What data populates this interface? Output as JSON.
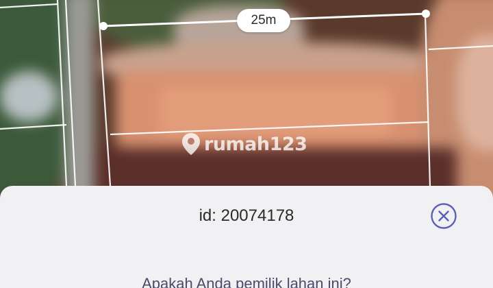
{
  "map": {
    "measurement_label": "25m",
    "watermark_text": "rumah123",
    "watermark_icon": "location-pin-icon",
    "boundary_color": "#ffffff"
  },
  "sheet": {
    "id_text": "id: 20074178",
    "question": "Apakah Anda pemilik lahan ini?",
    "close_icon": "close-circle-icon",
    "accent_color": "#5b5fb5"
  }
}
